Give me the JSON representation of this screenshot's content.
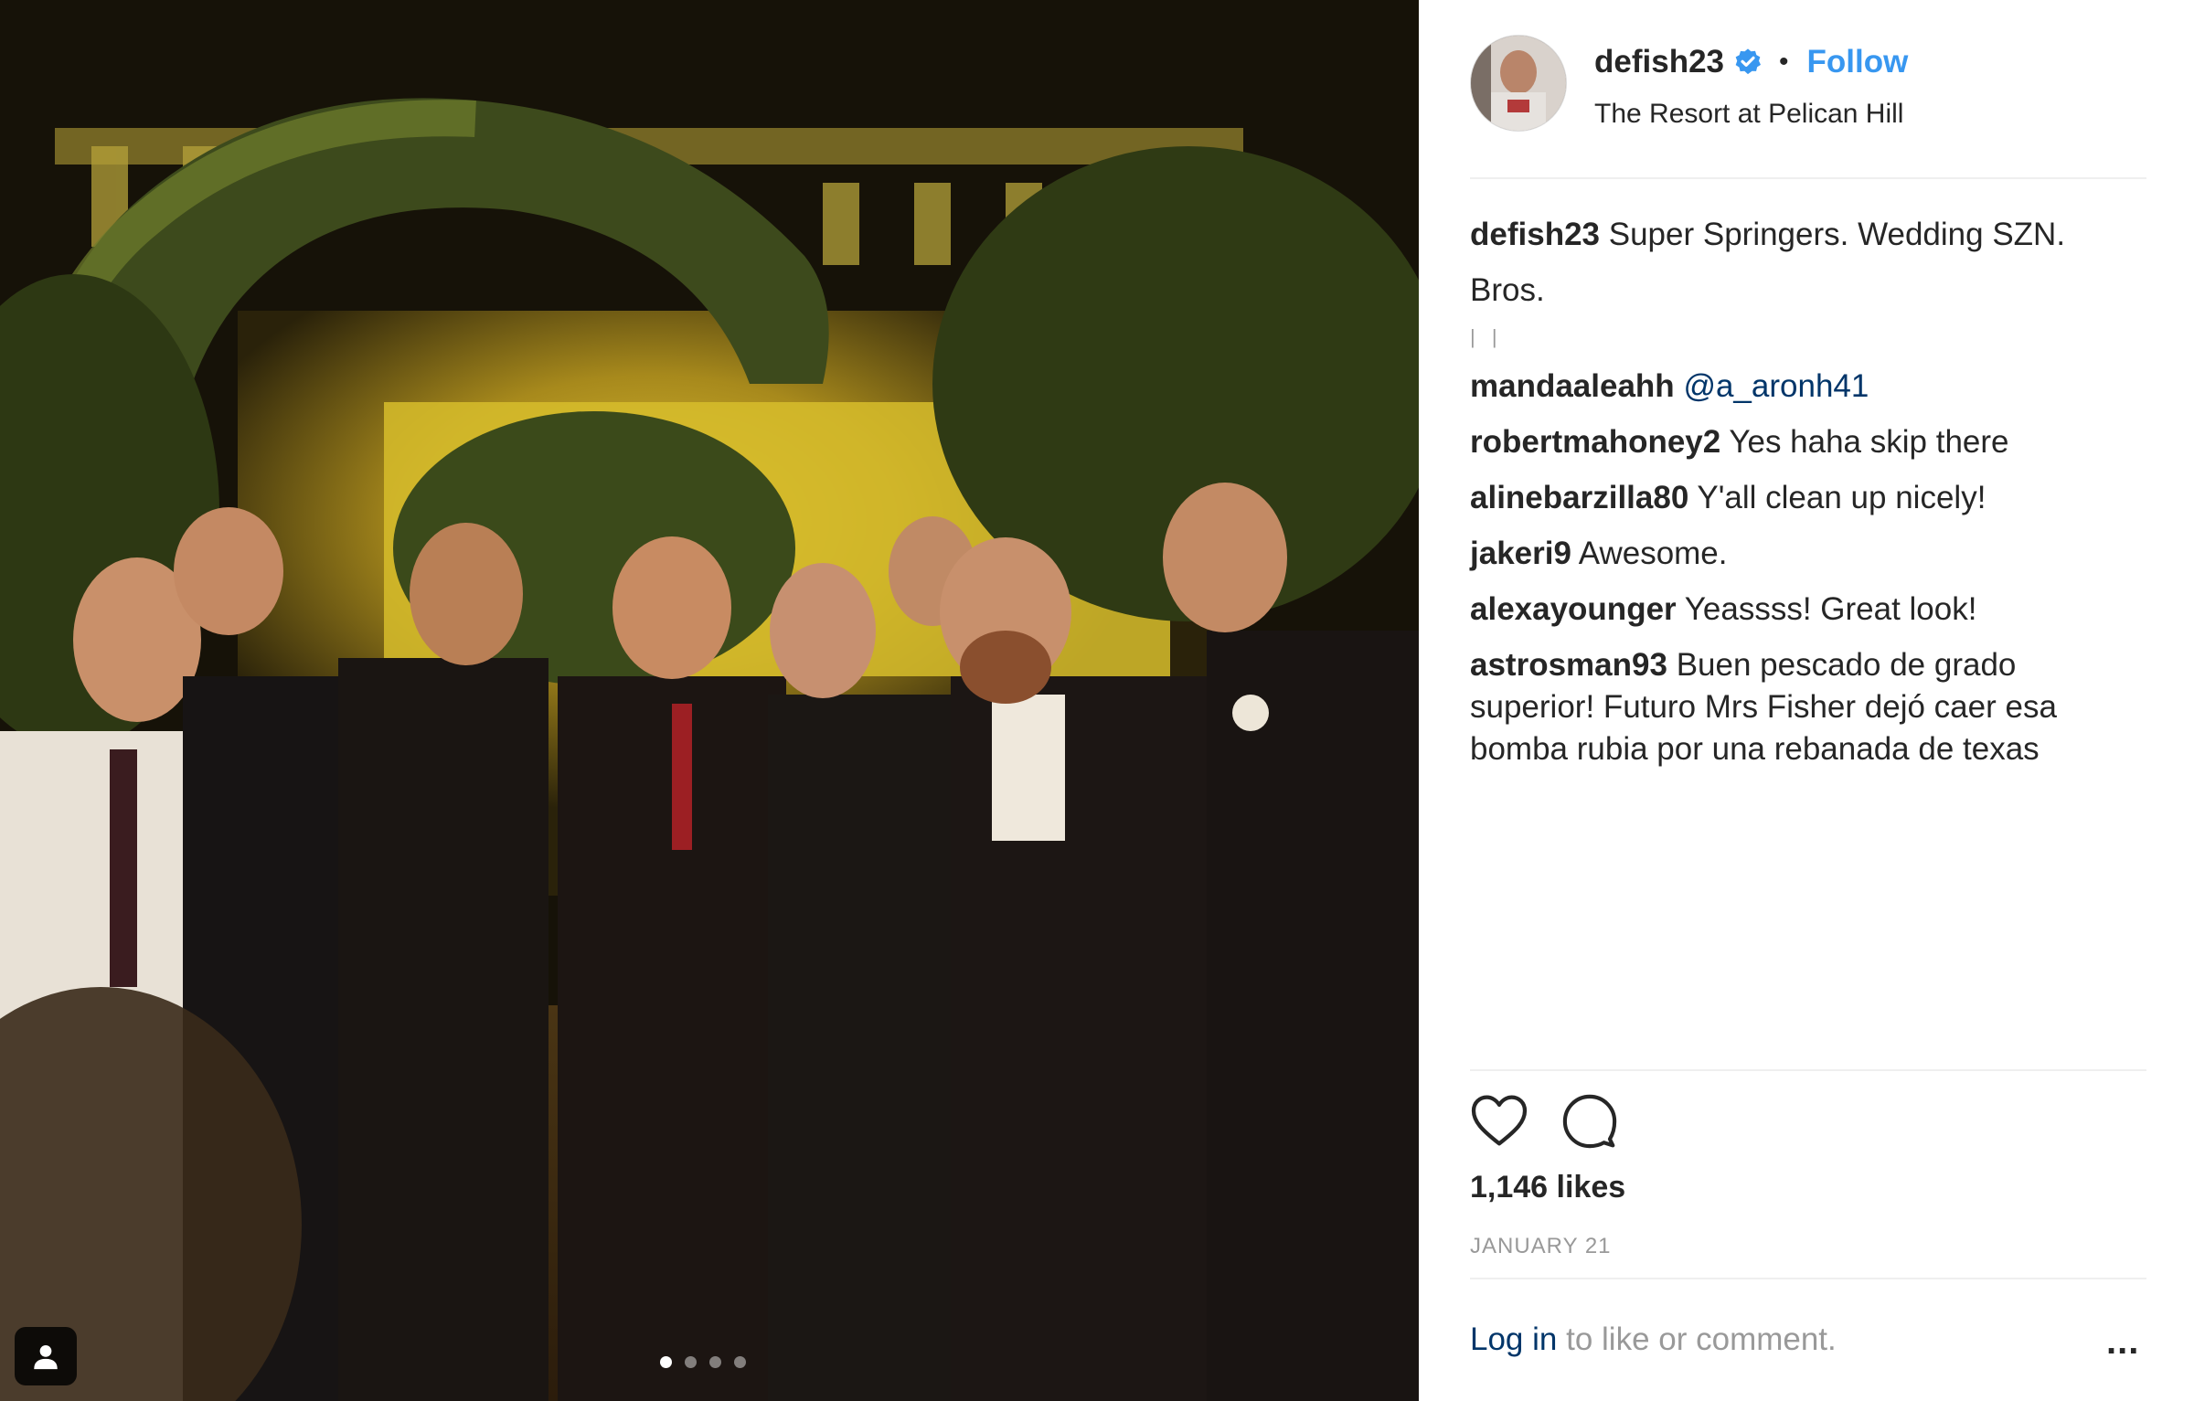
{
  "post": {
    "username": "defish23",
    "separator": "•",
    "follow_label": "Follow",
    "location": "The Resort at Pelican Hill",
    "caption_user": "defish23",
    "caption_text": "Super Springers. Wedding SZN. Bros.",
    "caption_ellipsis": "| |"
  },
  "comments": [
    {
      "user": "mandaaleahh",
      "mention": "@a_aronh41",
      "text": ""
    },
    {
      "user": "robertmahoney2",
      "text": "Yes haha skip there"
    },
    {
      "user": "alinebarzilla80",
      "text": "Y'all clean up nicely!"
    },
    {
      "user": "jakeri9",
      "text": "Awesome."
    },
    {
      "user": "alexayounger",
      "text": "Yeassss! Great look!"
    },
    {
      "user": "astrosman93",
      "text": "Buen pescado de grado superior! Futuro Mrs Fisher dejó caer esa bomba rubia por una rebanada de texas"
    }
  ],
  "stats": {
    "likes": "1,146 likes",
    "date": "JANUARY 21"
  },
  "footer": {
    "login_link": "Log in",
    "login_text": " to like or comment.",
    "more": "..."
  },
  "carousel": {
    "count": 4,
    "active": 1
  },
  "icons": {
    "like": "heart-icon",
    "comment": "comment-icon",
    "verified": "verified-badge-icon",
    "tag": "user-tag-icon",
    "more": "more-options-icon"
  },
  "colors": {
    "follow": "#3897f0",
    "mention": "#003569",
    "muted": "#999999",
    "divider": "#efefef"
  }
}
